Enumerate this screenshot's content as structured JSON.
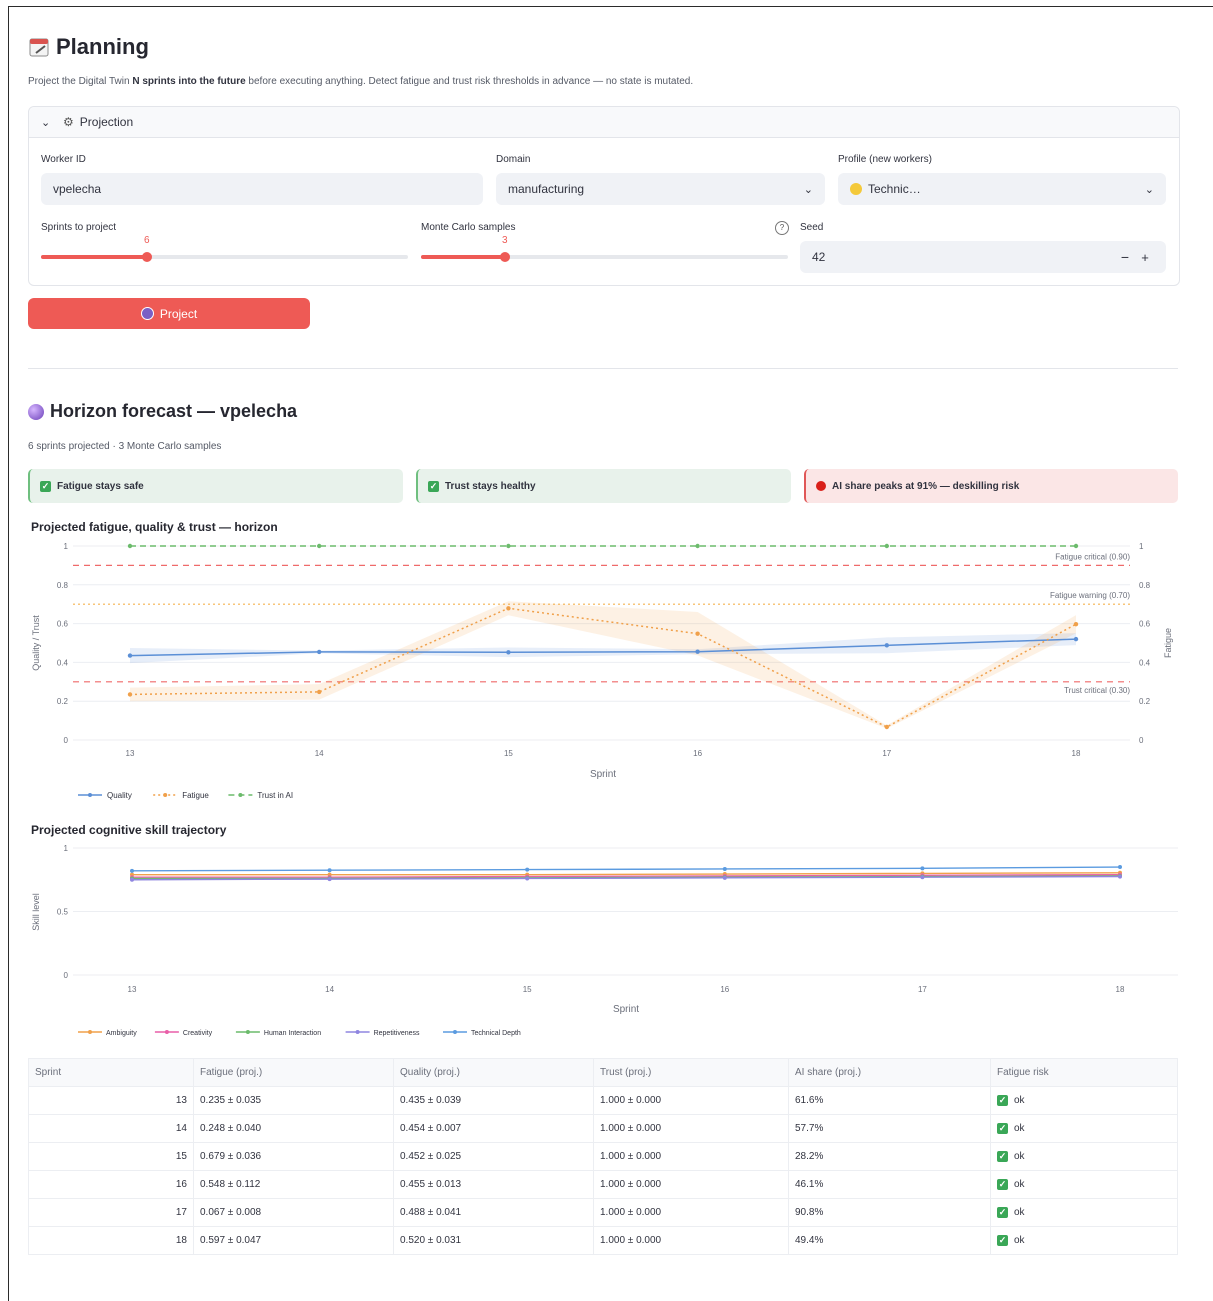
{
  "page": {
    "title_icon": "calendar-icon",
    "title": "Planning",
    "subtitle_pre": "Project the Digital Twin ",
    "subtitle_bold": "N sprints into the future",
    "subtitle_post": " before executing anything. Detect fatigue and trust risk thresholds in advance — no state is mutated."
  },
  "projection": {
    "header": "Projection",
    "worker_id_label": "Worker ID",
    "worker_id_value": "vpelecha",
    "domain_label": "Domain",
    "domain_value": "manufacturing",
    "profile_label": "Profile (new workers)",
    "profile_value": "Technic…",
    "sprints_label": "Sprints to project",
    "sprints_value": "6",
    "sprints_fraction": 0.29,
    "mc_label": "Monte Carlo samples",
    "mc_value": "3",
    "mc_fraction": 0.23,
    "seed_label": "Seed",
    "seed_value": "42",
    "minus": "−",
    "plus": "+",
    "project_button": "Project"
  },
  "forecast": {
    "title": "Horizon forecast — vpelecha",
    "caption": "6 sprints projected · 3 Monte Carlo samples",
    "alerts": [
      {
        "text": "Fatigue stays safe",
        "status": "ok"
      },
      {
        "text": "Trust stays healthy",
        "status": "ok"
      },
      {
        "text": "AI share peaks at 91% — deskilling risk",
        "status": "bad"
      }
    ]
  },
  "chart_data": [
    {
      "type": "line",
      "title": "Projected fatigue, quality & trust — horizon",
      "xlabel": "Sprint",
      "ylabel": "Quality / Trust",
      "y2label": "Fatigue",
      "x": [
        13,
        14,
        15,
        16,
        17,
        18
      ],
      "ylim": [
        0,
        1
      ],
      "yticks": [
        "0",
        "0.2",
        "0.4",
        "0.6",
        "0.8",
        "1"
      ],
      "series": [
        {
          "name": "Quality",
          "color": "#5b8fd6",
          "values": [
            0.435,
            0.454,
            0.452,
            0.455,
            0.488,
            0.52
          ],
          "band": [
            0.039,
            0.007,
            0.025,
            0.013,
            0.041,
            0.031
          ]
        },
        {
          "name": "Fatigue",
          "color": "#f0a04a",
          "values": [
            0.235,
            0.248,
            0.679,
            0.548,
            0.067,
            0.597
          ],
          "band": [
            0.035,
            0.04,
            0.036,
            0.112,
            0.008,
            0.047
          ],
          "dotted": true
        },
        {
          "name": "Trust in AI",
          "color": "#6cbb6c",
          "values": [
            1.0,
            1.0,
            1.0,
            1.0,
            1.0,
            1.0
          ],
          "dashed": true
        }
      ],
      "thresholds": [
        {
          "label": "Fatigue critical (0.90)",
          "value": 0.9,
          "color": "#ef6a6a",
          "style": "dash"
        },
        {
          "label": "Fatigue warning (0.70)",
          "value": 0.7,
          "color": "#f5b24e",
          "style": "dot"
        },
        {
          "label": "Trust critical (0.30)",
          "value": 0.3,
          "color": "#ef6a6a",
          "style": "dash"
        }
      ]
    },
    {
      "type": "line",
      "title": "Projected cognitive skill trajectory",
      "xlabel": "Sprint",
      "ylabel": "Skill level",
      "x": [
        13,
        14,
        15,
        16,
        17,
        18
      ],
      "ylim": [
        0,
        1
      ],
      "yticks": [
        "0",
        "0.5",
        "1"
      ],
      "series": [
        {
          "name": "Ambiguity",
          "color": "#f0a04a",
          "values": [
            0.79,
            0.79,
            0.79,
            0.795,
            0.8,
            0.805
          ]
        },
        {
          "name": "Creativity",
          "color": "#e95fa8",
          "values": [
            0.77,
            0.77,
            0.775,
            0.78,
            0.785,
            0.79
          ]
        },
        {
          "name": "Human Interaction",
          "color": "#6cbb6c",
          "values": [
            0.76,
            0.76,
            0.765,
            0.77,
            0.775,
            0.78
          ]
        },
        {
          "name": "Repetitiveness",
          "color": "#8f86e0",
          "values": [
            0.75,
            0.755,
            0.76,
            0.765,
            0.77,
            0.775
          ]
        },
        {
          "name": "Technical Depth",
          "color": "#5b9be0",
          "values": [
            0.82,
            0.825,
            0.83,
            0.835,
            0.84,
            0.85
          ]
        }
      ]
    }
  ],
  "table": {
    "headers": [
      "Sprint",
      "Fatigue (proj.)",
      "Quality (proj.)",
      "Trust (proj.)",
      "AI share (proj.)",
      "Fatigue risk"
    ],
    "rows": [
      [
        "13",
        "0.235 ± 0.035",
        "0.435 ± 0.039",
        "1.000 ± 0.000",
        "61.6%",
        "ok"
      ],
      [
        "14",
        "0.248 ± 0.040",
        "0.454 ± 0.007",
        "1.000 ± 0.000",
        "57.7%",
        "ok"
      ],
      [
        "15",
        "0.679 ± 0.036",
        "0.452 ± 0.025",
        "1.000 ± 0.000",
        "28.2%",
        "ok"
      ],
      [
        "16",
        "0.548 ± 0.112",
        "0.455 ± 0.013",
        "1.000 ± 0.000",
        "46.1%",
        "ok"
      ],
      [
        "17",
        "0.067 ± 0.008",
        "0.488 ± 0.041",
        "1.000 ± 0.000",
        "90.8%",
        "ok"
      ],
      [
        "18",
        "0.597 ± 0.047",
        "0.520 ± 0.031",
        "1.000 ± 0.000",
        "49.4%",
        "ok"
      ]
    ]
  }
}
